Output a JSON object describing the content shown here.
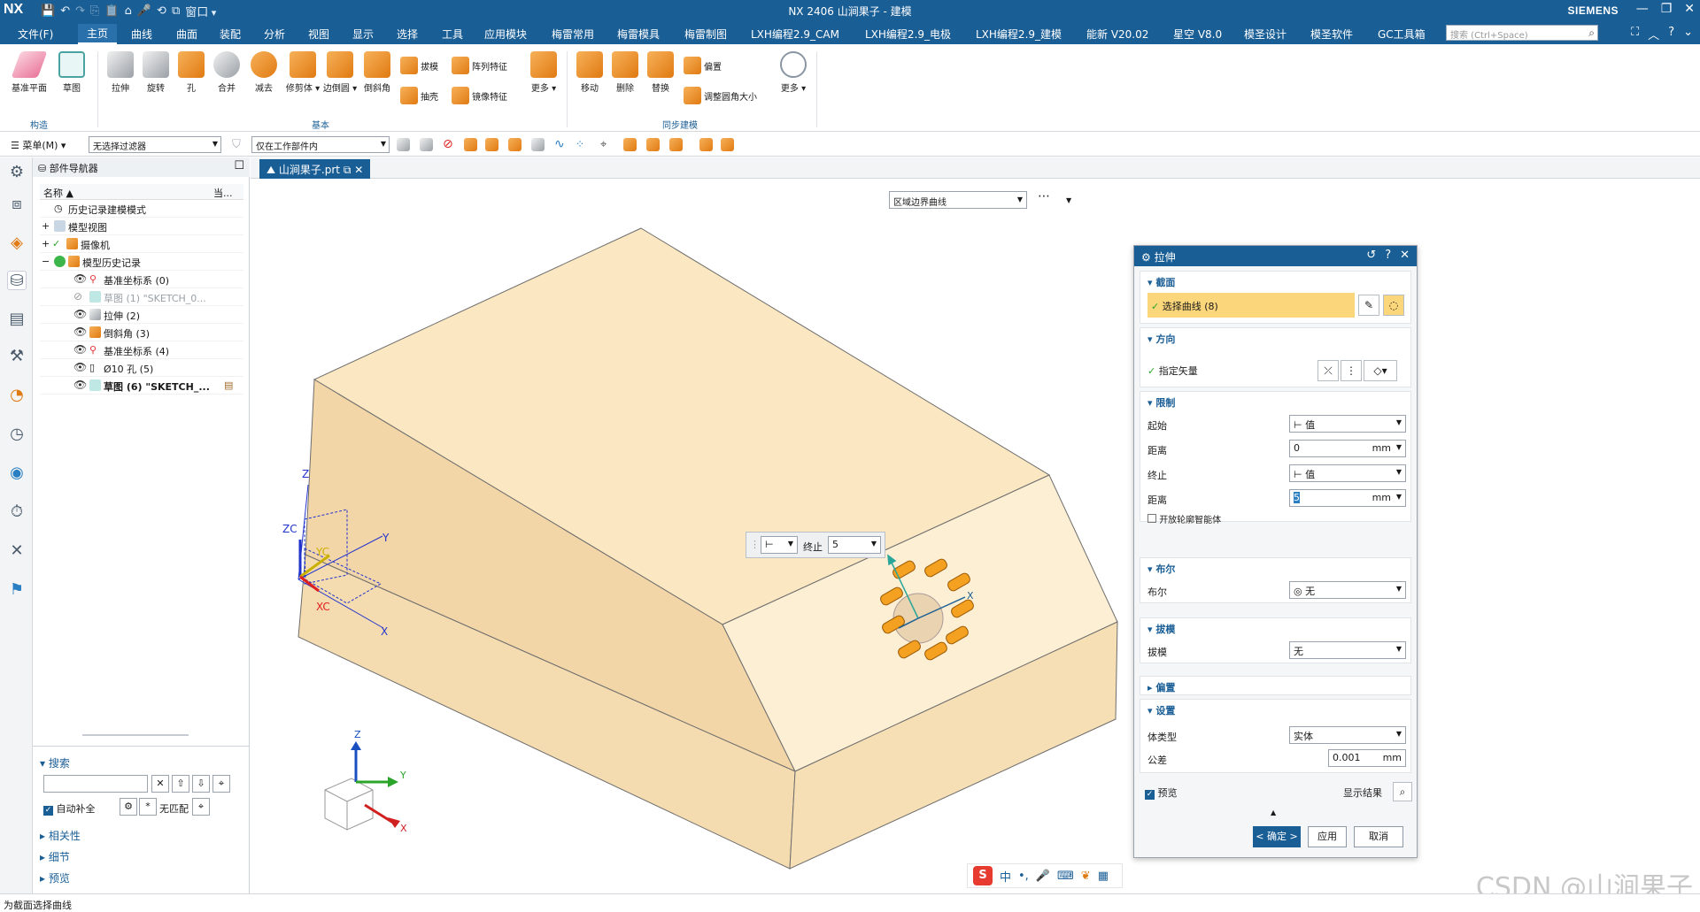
{
  "titlebar": {
    "logo": "NX",
    "title": "NX 2406 山涧果子 - 建模",
    "brand": "SIEMENS",
    "window_menu": "窗口"
  },
  "menubar": {
    "items": [
      "文件(F)",
      "主页",
      "曲线",
      "曲面",
      "装配",
      "分析",
      "视图",
      "显示",
      "选择",
      "工具",
      "应用模块",
      "梅雷常用",
      "梅雷模具",
      "梅雷制图",
      "LXH编程2.9_CAM",
      "LXH编程2.9_电极",
      "LXH编程2.9_建模",
      "能新 V20.02",
      "星空 V8.0",
      "模圣设计",
      "模圣软件",
      "GC工具箱"
    ],
    "active": "主页",
    "search_placeholder": "搜索 (Ctrl+Space)"
  },
  "ribbon": {
    "construct": {
      "label": "构造",
      "items": [
        "基准平面",
        "草图"
      ]
    },
    "basic": {
      "label": "基本",
      "items": [
        "拉伸",
        "旋转",
        "孔",
        "合并",
        "减去",
        "修剪体",
        "边倒圆",
        "倒斜角"
      ],
      "small": [
        "拔模",
        "阵列特征",
        "抽壳",
        "镜像特征"
      ],
      "more": "更多"
    },
    "sync": {
      "label": "同步建模",
      "items": [
        "移动",
        "删除",
        "替换"
      ],
      "small": [
        "偏置",
        "调整圆角大小"
      ],
      "more": "更多"
    }
  },
  "toolbar": {
    "menu_label": "菜单(M)",
    "filter": "无选择过滤器",
    "scope": "仅在工作部件内"
  },
  "navigator": {
    "title": "部件导航器",
    "col_name": "名称",
    "col_current": "当...",
    "rows": [
      {
        "label": "历史记录建模模式",
        "indent": 1
      },
      {
        "label": "模型视图",
        "indent": 0
      },
      {
        "label": "摄像机",
        "indent": 0
      },
      {
        "label": "模型历史记录",
        "indent": 0
      },
      {
        "label": "基准坐标系 (0)",
        "indent": 2
      },
      {
        "label": "草图 (1) \"SKETCH_0...",
        "indent": 2
      },
      {
        "label": "拉伸 (2)",
        "indent": 2
      },
      {
        "label": "倒斜角 (3)",
        "indent": 2
      },
      {
        "label": "基准坐标系 (4)",
        "indent": 2
      },
      {
        "label": "Ø10 孔 (5)",
        "indent": 2
      },
      {
        "label": "草图 (6) \"SKETCH_...",
        "indent": 2
      }
    ],
    "search_title": "搜索",
    "autocomplete": "自动补全",
    "no_match": "无匹配",
    "sections": [
      "相关性",
      "细节",
      "预览"
    ]
  },
  "document_tab": "山涧果子.prt",
  "curve_rule": "区域边界曲线",
  "floating_input": {
    "end_label": "终止",
    "end_value": "5"
  },
  "axes": {
    "z": "Z",
    "y": "Y",
    "x": "X",
    "zc": "ZC",
    "yc": "YC",
    "xc": "XC"
  },
  "dialog": {
    "title": "拉伸",
    "section": {
      "title": "截面",
      "select": "选择曲线 (8)"
    },
    "direction": {
      "title": "方向",
      "vector": "指定矢量"
    },
    "limits": {
      "title": "限制",
      "start_label": "起始",
      "start_value": "值",
      "dist1_label": "距离",
      "dist1_value": "0",
      "end_label": "终止",
      "end_value": "值",
      "dist2_label": "距离",
      "dist2_value": "5",
      "unit": "mm",
      "open_profile": "开放轮廓智能体"
    },
    "boolean": {
      "title": "布尔",
      "label": "布尔",
      "value": "无"
    },
    "draft": {
      "title": "拔模",
      "label": "拔模",
      "value": "无"
    },
    "offset": {
      "title": "偏置"
    },
    "settings": {
      "title": "设置",
      "body_type_label": "体类型",
      "body_type": "实体",
      "tolerance_label": "公差",
      "tolerance": "0.001",
      "unit": "mm"
    },
    "preview": "预览",
    "show_result": "显示结果",
    "ok": "< 确定 >",
    "apply": "应用",
    "cancel": "取消"
  },
  "status": "为截面选择曲线",
  "watermark": "CSDN @山涧果子",
  "colors": {
    "accent": "#1a5e96",
    "solid_top": "#fbe8c2",
    "solid_front": "#f7dfb5",
    "solid_side": "#fbeccc",
    "highlight": "#fbd67a"
  }
}
